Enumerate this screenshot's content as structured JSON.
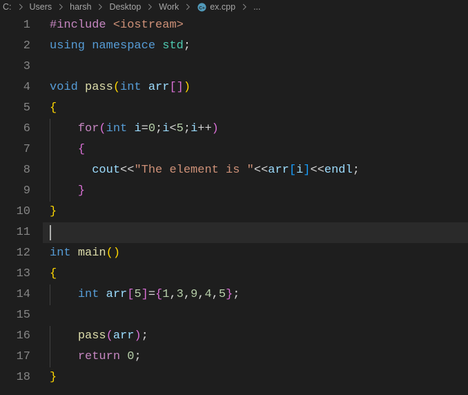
{
  "breadcrumbs": {
    "items": [
      "C:",
      "Users",
      "harsh",
      "Desktop",
      "Work"
    ],
    "file": "ex.cpp",
    "ellipsis": "..."
  },
  "editor": {
    "current_line": 11,
    "indent_unit": 4,
    "lines": [
      {
        "n": 1,
        "indent": 0,
        "tokens": [
          {
            "t": "#include ",
            "c": "tk-pre"
          },
          {
            "t": "<iostream>",
            "c": "tk-str"
          }
        ]
      },
      {
        "n": 2,
        "indent": 0,
        "tokens": [
          {
            "t": "using",
            "c": "tk-kw"
          },
          {
            "t": " ",
            "c": "tk-pl"
          },
          {
            "t": "namespace",
            "c": "tk-kw"
          },
          {
            "t": " ",
            "c": "tk-pl"
          },
          {
            "t": "std",
            "c": "tk-ns"
          },
          {
            "t": ";",
            "c": "tk-punc"
          }
        ]
      },
      {
        "n": 3,
        "indent": 0,
        "tokens": []
      },
      {
        "n": 4,
        "indent": 0,
        "tokens": [
          {
            "t": "void",
            "c": "tk-type"
          },
          {
            "t": " ",
            "c": "tk-pl"
          },
          {
            "t": "pass",
            "c": "tk-fn"
          },
          {
            "t": "(",
            "c": "tk-brace1"
          },
          {
            "t": "int",
            "c": "tk-type"
          },
          {
            "t": " ",
            "c": "tk-pl"
          },
          {
            "t": "arr",
            "c": "tk-var"
          },
          {
            "t": "[]",
            "c": "tk-brace"
          },
          {
            "t": ")",
            "c": "tk-brace1"
          }
        ]
      },
      {
        "n": 5,
        "indent": 0,
        "tokens": [
          {
            "t": "{",
            "c": "tk-brace1"
          }
        ]
      },
      {
        "n": 6,
        "indent": 1,
        "tokens": [
          {
            "t": "for",
            "c": "tk-ctrl"
          },
          {
            "t": "(",
            "c": "tk-brace"
          },
          {
            "t": "int",
            "c": "tk-type"
          },
          {
            "t": " ",
            "c": "tk-pl"
          },
          {
            "t": "i",
            "c": "tk-var"
          },
          {
            "t": "=",
            "c": "tk-op"
          },
          {
            "t": "0",
            "c": "tk-num"
          },
          {
            "t": ";",
            "c": "tk-punc"
          },
          {
            "t": "i",
            "c": "tk-var"
          },
          {
            "t": "<",
            "c": "tk-op"
          },
          {
            "t": "5",
            "c": "tk-num"
          },
          {
            "t": ";",
            "c": "tk-punc"
          },
          {
            "t": "i",
            "c": "tk-var"
          },
          {
            "t": "++",
            "c": "tk-op"
          },
          {
            "t": ")",
            "c": "tk-brace"
          }
        ]
      },
      {
        "n": 7,
        "indent": 1,
        "tokens": [
          {
            "t": "{",
            "c": "tk-brace"
          }
        ]
      },
      {
        "n": 8,
        "indent": 1,
        "tokens": [
          {
            "t": "  ",
            "c": "tk-pl"
          },
          {
            "t": "cout",
            "c": "tk-var"
          },
          {
            "t": "<<",
            "c": "tk-op"
          },
          {
            "t": "\"The element is \"",
            "c": "tk-str"
          },
          {
            "t": "<<",
            "c": "tk-op"
          },
          {
            "t": "arr",
            "c": "tk-var"
          },
          {
            "t": "[",
            "c": "tk-brace2"
          },
          {
            "t": "i",
            "c": "tk-var"
          },
          {
            "t": "]",
            "c": "tk-brace2"
          },
          {
            "t": "<<",
            "c": "tk-op"
          },
          {
            "t": "endl",
            "c": "tk-var"
          },
          {
            "t": ";",
            "c": "tk-punc"
          }
        ]
      },
      {
        "n": 9,
        "indent": 1,
        "tokens": [
          {
            "t": "}",
            "c": "tk-brace"
          }
        ]
      },
      {
        "n": 10,
        "indent": 0,
        "tokens": [
          {
            "t": "}",
            "c": "tk-brace1"
          }
        ]
      },
      {
        "n": 11,
        "indent": 0,
        "tokens": []
      },
      {
        "n": 12,
        "indent": 0,
        "tokens": [
          {
            "t": "int",
            "c": "tk-type"
          },
          {
            "t": " ",
            "c": "tk-pl"
          },
          {
            "t": "main",
            "c": "tk-fn"
          },
          {
            "t": "()",
            "c": "tk-brace1"
          }
        ]
      },
      {
        "n": 13,
        "indent": 0,
        "tokens": [
          {
            "t": "{",
            "c": "tk-brace1"
          }
        ]
      },
      {
        "n": 14,
        "indent": 1,
        "tokens": [
          {
            "t": "int",
            "c": "tk-type"
          },
          {
            "t": " ",
            "c": "tk-pl"
          },
          {
            "t": "arr",
            "c": "tk-var"
          },
          {
            "t": "[",
            "c": "tk-brace"
          },
          {
            "t": "5",
            "c": "tk-num"
          },
          {
            "t": "]",
            "c": "tk-brace"
          },
          {
            "t": "=",
            "c": "tk-op"
          },
          {
            "t": "{",
            "c": "tk-brace"
          },
          {
            "t": "1",
            "c": "tk-num"
          },
          {
            "t": ",",
            "c": "tk-punc"
          },
          {
            "t": "3",
            "c": "tk-num"
          },
          {
            "t": ",",
            "c": "tk-punc"
          },
          {
            "t": "9",
            "c": "tk-num"
          },
          {
            "t": ",",
            "c": "tk-punc"
          },
          {
            "t": "4",
            "c": "tk-num"
          },
          {
            "t": ",",
            "c": "tk-punc"
          },
          {
            "t": "5",
            "c": "tk-num"
          },
          {
            "t": "}",
            "c": "tk-brace"
          },
          {
            "t": ";",
            "c": "tk-punc"
          }
        ]
      },
      {
        "n": 15,
        "indent": 0,
        "tokens": []
      },
      {
        "n": 16,
        "indent": 1,
        "tokens": [
          {
            "t": "pass",
            "c": "tk-fn"
          },
          {
            "t": "(",
            "c": "tk-brace"
          },
          {
            "t": "arr",
            "c": "tk-var"
          },
          {
            "t": ")",
            "c": "tk-brace"
          },
          {
            "t": ";",
            "c": "tk-punc"
          }
        ]
      },
      {
        "n": 17,
        "indent": 1,
        "tokens": [
          {
            "t": "return",
            "c": "tk-ctrl"
          },
          {
            "t": " ",
            "c": "tk-pl"
          },
          {
            "t": "0",
            "c": "tk-num"
          },
          {
            "t": ";",
            "c": "tk-punc"
          }
        ]
      },
      {
        "n": 18,
        "indent": 0,
        "tokens": [
          {
            "t": "}",
            "c": "tk-brace1"
          }
        ]
      }
    ]
  }
}
